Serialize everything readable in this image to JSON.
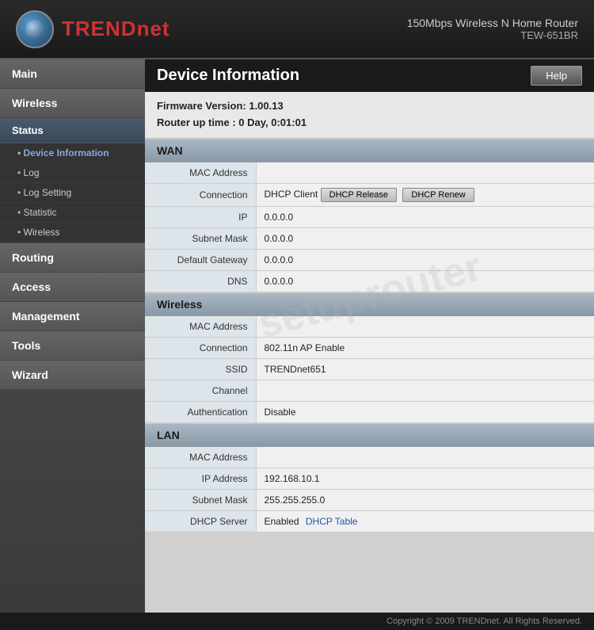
{
  "header": {
    "brand": "TRENDnet",
    "brand_prefix": "TREND",
    "brand_suffix": "net",
    "product_name": "150Mbps Wireless N Home Router",
    "model": "TEW-651BR"
  },
  "sidebar": {
    "items": [
      {
        "id": "main",
        "label": "Main"
      },
      {
        "id": "wireless",
        "label": "Wireless"
      },
      {
        "id": "status",
        "label": "Status",
        "submenu": [
          {
            "id": "device-info",
            "label": "Device Information",
            "active": true
          },
          {
            "id": "log",
            "label": "Log"
          },
          {
            "id": "log-setting",
            "label": "Log Setting"
          },
          {
            "id": "statistic",
            "label": "Statistic"
          },
          {
            "id": "wireless-status",
            "label": "Wireless"
          }
        ]
      },
      {
        "id": "routing",
        "label": "Routing"
      },
      {
        "id": "access",
        "label": "Access"
      },
      {
        "id": "management",
        "label": "Management"
      },
      {
        "id": "tools",
        "label": "Tools"
      },
      {
        "id": "wizard",
        "label": "Wizard"
      }
    ]
  },
  "page": {
    "title": "Device Information",
    "help_label": "Help",
    "firmware_label": "Firmware Version:",
    "firmware_version": "1.00.13",
    "uptime_label": "Router up time :",
    "uptime_value": "0 Day, 0:01:01"
  },
  "wan": {
    "section_label": "WAN",
    "mac_address_label": "MAC Address",
    "mac_address_value": "",
    "connection_label": "Connection",
    "connection_type": "DHCP Client",
    "dhcp_release_label": "DHCP Release",
    "dhcp_renew_label": "DHCP Renew",
    "ip_label": "IP",
    "ip_value": "0.0.0.0",
    "subnet_mask_label": "Subnet Mask",
    "subnet_mask_value": "0.0.0.0",
    "default_gateway_label": "Default Gateway",
    "default_gateway_value": "0.0.0.0",
    "dns_label": "DNS",
    "dns_value": "0.0.0.0"
  },
  "wireless": {
    "section_label": "Wireless",
    "mac_address_label": "MAC Address",
    "mac_address_value": "",
    "connection_label": "Connection",
    "connection_value": "802.11n AP Enable",
    "ssid_label": "SSID",
    "ssid_value": "TRENDnet651",
    "channel_label": "Channel",
    "channel_value": "",
    "auth_label": "Authentication",
    "auth_value": "Disable"
  },
  "lan": {
    "section_label": "LAN",
    "mac_address_label": "MAC Address",
    "mac_address_value": "",
    "ip_address_label": "IP Address",
    "ip_address_value": "192.168.10.1",
    "subnet_mask_label": "Subnet Mask",
    "subnet_mask_value": "255.255.255.0",
    "dhcp_server_label": "DHCP Server",
    "dhcp_server_status": "Enabled",
    "dhcp_table_label": "DHCP Table"
  },
  "footer": {
    "copyright": "Copyright © 2009 TRENDnet. All Rights Reserved."
  },
  "watermark": {
    "text": "setuprouter"
  }
}
